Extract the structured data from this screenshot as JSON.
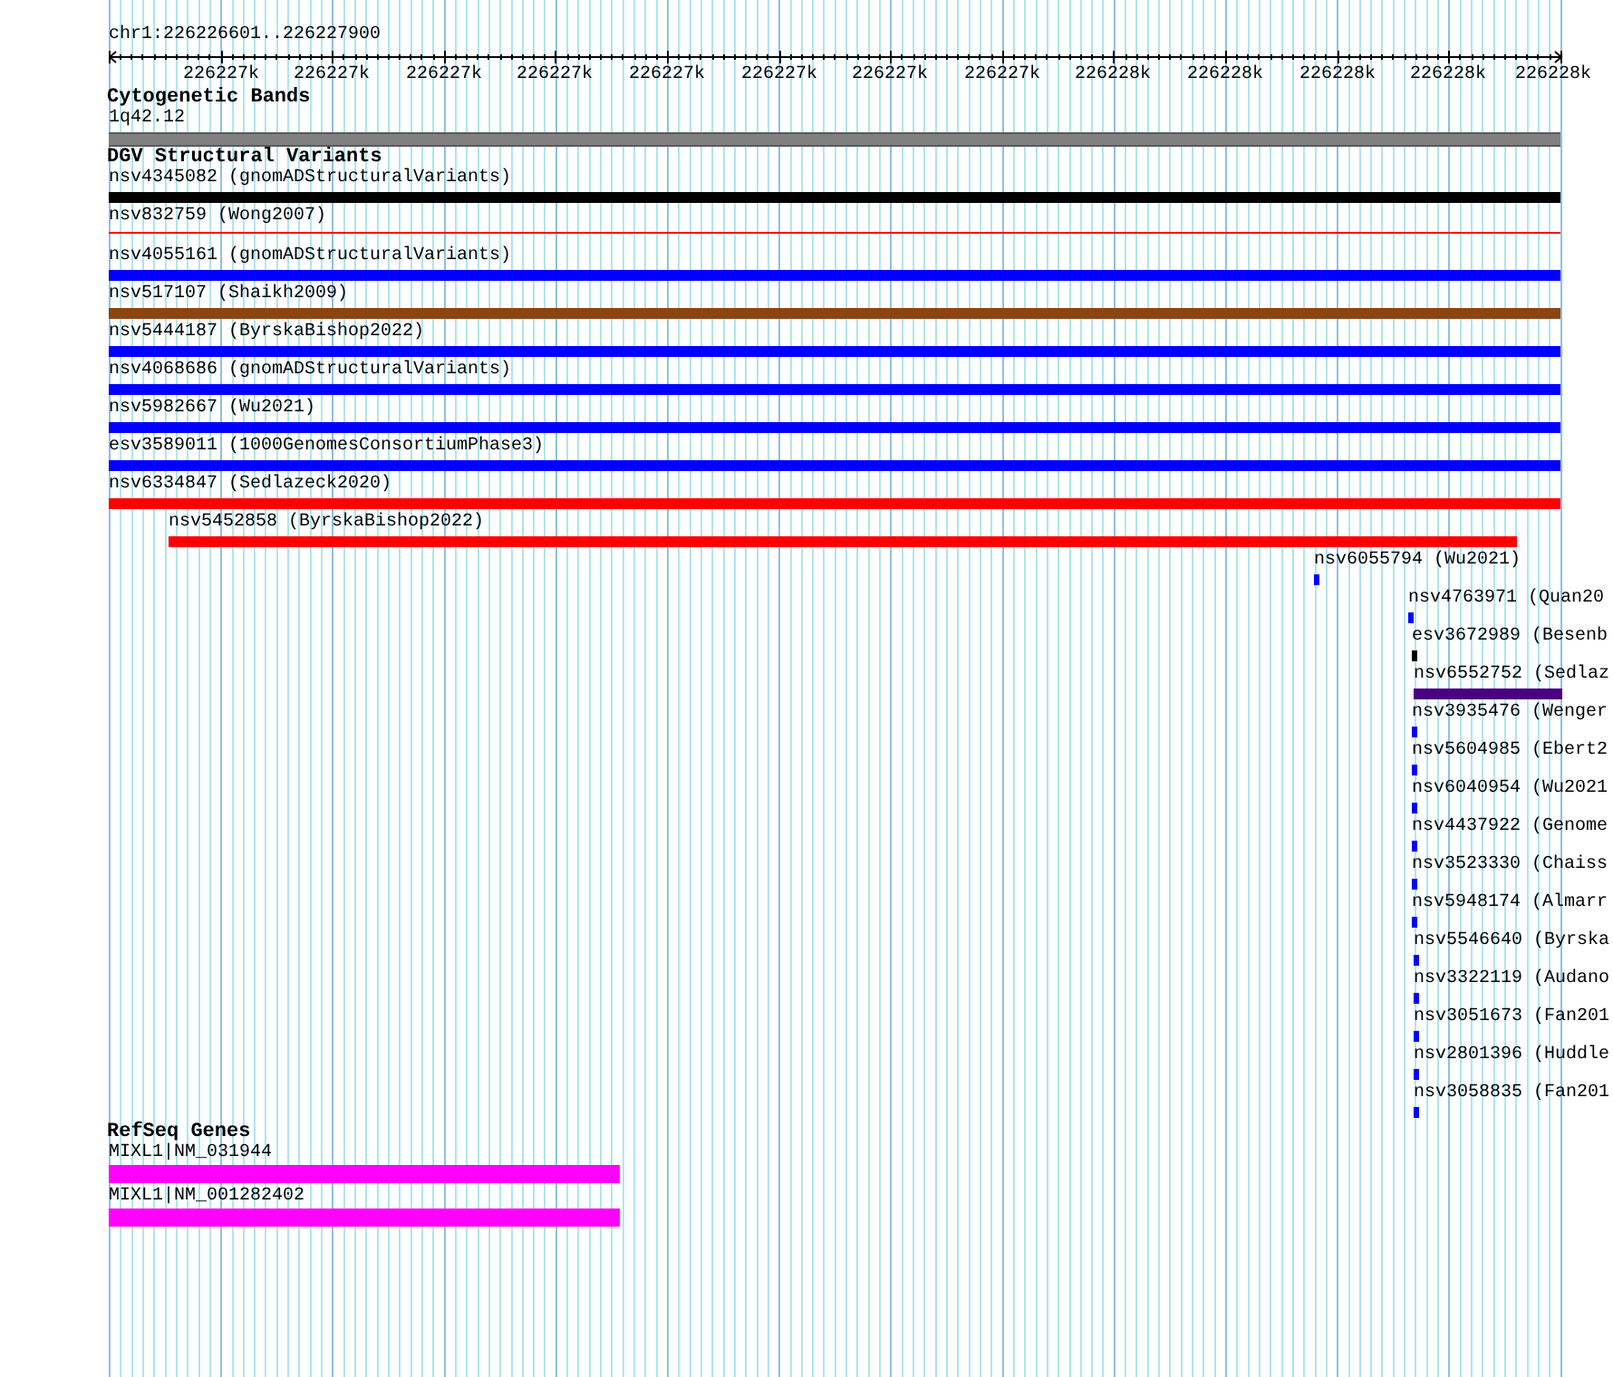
{
  "location": "chr1:226226601..226227900",
  "ruler": {
    "ticks": [
      "226227k",
      "226227k",
      "226227k",
      "226227k",
      "226227k",
      "226227k",
      "226227k",
      "226227k",
      "226228k",
      "226228k",
      "226228k",
      "226228k",
      "226228k"
    ]
  },
  "tracks": [
    {
      "title": "Cytogenetic Bands",
      "features": [
        {
          "label": "1q42.12",
          "kind": "band"
        }
      ]
    },
    {
      "title": "DGV Structural Variants",
      "features": [
        {
          "label": "nsv4345082 (gnomADStructuralVariants)",
          "kind": "bar",
          "color": "#000000"
        },
        {
          "label": "nsv832759 (Wong2007)",
          "kind": "line",
          "color": "#ff0000"
        },
        {
          "label": "nsv4055161 (gnomADStructuralVariants)",
          "kind": "bar",
          "color": "#0000ff"
        },
        {
          "label": "nsv517107 (Shaikh2009)",
          "kind": "bar",
          "color": "#8b4513"
        },
        {
          "label": "nsv5444187 (ByrskaBishop2022)",
          "kind": "bar",
          "color": "#0000ff"
        },
        {
          "label": "nsv4068686 (gnomADStructuralVariants)",
          "kind": "bar",
          "color": "#0000ff"
        },
        {
          "label": "nsv5982667 (Wu2021)",
          "kind": "bar",
          "color": "#0000ff"
        },
        {
          "label": "esv3589011 (1000GenomesConsortiumPhase3)",
          "kind": "bar",
          "color": "#0000ff"
        },
        {
          "label": "nsv6334847 (Sedlazeck2020)",
          "kind": "bar",
          "color": "#ff0000"
        },
        {
          "label": "nsv5452858 (ByrskaBishop2022)",
          "kind": "bar",
          "color": "#ff0000"
        },
        {
          "label": "nsv6055794 (Wu2021)",
          "kind": "bar",
          "color": "#0000ff"
        },
        {
          "label": "nsv4763971 (Quan20",
          "kind": "bar",
          "color": "#0000ff"
        },
        {
          "label": "esv3672989 (Besenb",
          "kind": "bar",
          "color": "#000000"
        },
        {
          "label": "nsv6552752 (Sedlaz",
          "kind": "bar",
          "color": "#4b0082"
        },
        {
          "label": "nsv3935476 (Wenger",
          "kind": "bar",
          "color": "#0000ff"
        },
        {
          "label": "nsv5604985 (Ebert2",
          "kind": "bar",
          "color": "#0000ff"
        },
        {
          "label": "nsv6040954 (Wu2021",
          "kind": "bar",
          "color": "#0000ff"
        },
        {
          "label": "nsv4437922 (Genome",
          "kind": "bar",
          "color": "#0000ff"
        },
        {
          "label": "nsv3523330 (Chaiss",
          "kind": "bar",
          "color": "#0000ff"
        },
        {
          "label": "nsv5948174 (Almarr",
          "kind": "bar",
          "color": "#0000ff"
        },
        {
          "label": "nsv5546640 (Byrska",
          "kind": "bar",
          "color": "#0000ff"
        },
        {
          "label": "nsv3322119 (Audano",
          "kind": "bar",
          "color": "#0000ff"
        },
        {
          "label": "nsv3051673 (Fan201",
          "kind": "bar",
          "color": "#0000ff"
        },
        {
          "label": "nsv2801396 (Huddle",
          "kind": "bar",
          "color": "#0000ff"
        },
        {
          "label": "nsv3058835 (Fan201",
          "kind": "bar",
          "color": "#0000ff"
        }
      ]
    },
    {
      "title": "RefSeq Genes",
      "features": [
        {
          "label": "MIXL1|NM_031944",
          "kind": "gene"
        },
        {
          "label": "MIXL1|NM_001282402",
          "kind": "gene"
        }
      ]
    }
  ]
}
